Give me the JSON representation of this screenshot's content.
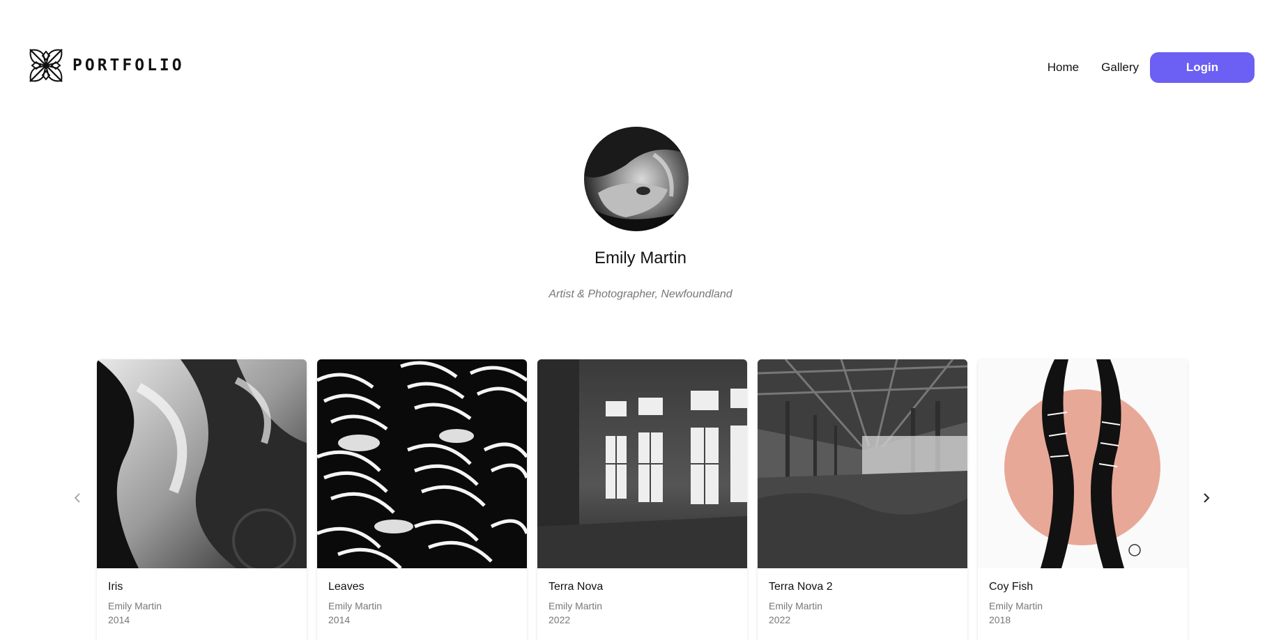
{
  "header": {
    "logo_text": "PORTFOLIO",
    "nav": {
      "home": "Home",
      "gallery": "Gallery",
      "login": "Login"
    }
  },
  "profile": {
    "name": "Emily Martin",
    "subtitle": "Artist & Photographer, Newfoundland"
  },
  "gallery": {
    "cards": [
      {
        "title": "Iris",
        "artist": "Emily Martin",
        "year": "2014"
      },
      {
        "title": "Leaves",
        "artist": "Emily Martin",
        "year": "2014"
      },
      {
        "title": "Terra Nova",
        "artist": "Emily Martin",
        "year": "2022"
      },
      {
        "title": "Terra Nova 2",
        "artist": "Emily Martin",
        "year": "2022"
      },
      {
        "title": "Coy Fish",
        "artist": "Emily Martin",
        "year": "2018"
      }
    ]
  },
  "colors": {
    "accent": "#6c5ff3",
    "muted_text": "#777777"
  },
  "icons": {
    "prev": "chevron-left-icon",
    "next": "chevron-right-icon",
    "logo": "flower-logo-icon"
  }
}
